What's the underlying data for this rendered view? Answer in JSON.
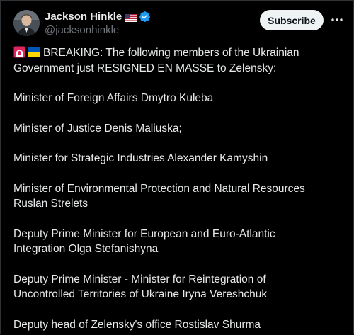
{
  "author": {
    "display_name": "Jackson Hinkle",
    "handle": "@jacksonhinkle",
    "flag_icon": "us-flag-icon",
    "verified_icon": "verified-badge-icon",
    "verified_color": "#1d9bf0"
  },
  "actions": {
    "subscribe_label": "Subscribe",
    "more_icon": "more-options-icon"
  },
  "tweet": {
    "emojis": [
      "rotating-light-icon",
      "ukraine-flag-icon"
    ],
    "headline_line1": "BREAKING: The following members of the Ukrainian",
    "headline_line2": "Government just RESIGNED EN MASSE to Zelensky:",
    "items": [
      {
        "line1": "Minister of Foreign Affairs Dmytro Kuleba",
        "line2": ""
      },
      {
        "line1": "Minister of Justice Denis Maliuska;",
        "line2": ""
      },
      {
        "line1": "Minister for Strategic Industries Alexander Kamyshin",
        "line2": ""
      },
      {
        "line1": "Minister of Environmental Protection and Natural Resources",
        "line2": "Ruslan Strelets"
      },
      {
        "line1": "Deputy Prime Minister for European and Euro-Atlantic",
        "line2": "Integration Olga Stefanishyna"
      },
      {
        "line1": "Deputy Prime Minister - Minister for Reintegration of",
        "line2": "Uncontrolled Territories of Ukraine Iryna Vereshchuk"
      },
      {
        "line1": "Deputy head of Zelensky's office Rostislav Shurma",
        "line2": ""
      }
    ]
  },
  "colors": {
    "background": "#000000",
    "text": "#e7e9ea",
    "muted": "#71767b",
    "button_bg": "#eff3f4"
  }
}
